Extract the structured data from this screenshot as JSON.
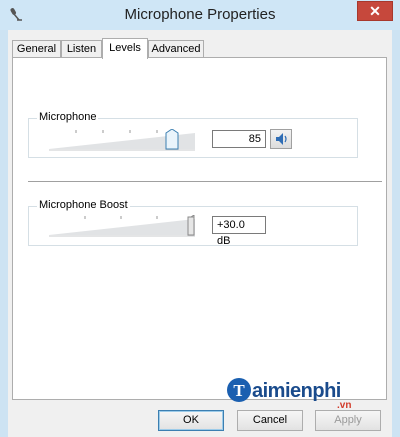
{
  "window": {
    "title": "Microphone Properties",
    "close_glyph": "✕"
  },
  "tabs": [
    {
      "label": "General",
      "active": false
    },
    {
      "label": "Listen",
      "active": false
    },
    {
      "label": "Levels",
      "active": true
    },
    {
      "label": "Advanced",
      "active": false
    }
  ],
  "levels": {
    "microphone": {
      "label": "Microphone",
      "value": "85",
      "level": 85,
      "mute_icon": "speaker-icon"
    },
    "boost": {
      "label": "Microphone Boost",
      "value": "+30.0 dB",
      "level": 100
    }
  },
  "buttons": {
    "ok": "OK",
    "cancel": "Cancel",
    "apply": "Apply"
  },
  "watermark": {
    "brand": "aimienphi",
    "suffix": ".vn"
  }
}
